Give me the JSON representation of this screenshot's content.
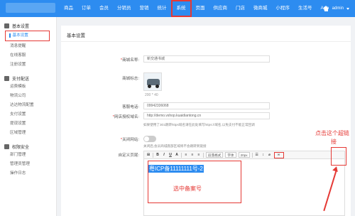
{
  "topbar": {
    "nav": [
      "商品",
      "订单",
      "会员",
      "分销员",
      "营销",
      "统计",
      "系统",
      "页面",
      "供应商",
      "门店",
      "微商城",
      "小程序",
      "生活号",
      "App"
    ],
    "active_nav": "系统",
    "user_name": "admin",
    "brand_color": "#2d8cf0"
  },
  "sidebar": {
    "groups": [
      {
        "title": "基本设置",
        "items": [
          "基本设置",
          "消息提醒",
          "在线客服",
          "注册设置"
        ]
      },
      {
        "title": "支付配送",
        "items": [
          "运费模板",
          "物流公司",
          "达达物流配置",
          "支付设置",
          "提现设置",
          "区域管理"
        ]
      },
      {
        "title": "权限安全",
        "items": [
          "部门管理",
          "管理员管理",
          "操作日志"
        ]
      }
    ],
    "active_item": "基本设置"
  },
  "main": {
    "section_title": "基本设置",
    "shop_name_label": "商城名称:",
    "shop_name_value": "新交通书城",
    "logo_label": "商城标志:",
    "logo_size": "200 * 40",
    "phone_label": "客服电话:",
    "phone_value": "09942336068",
    "domain_label": "网店授权域名:",
    "domain_value": "http://demo.vshop.kuaidiantong.cn",
    "domain_hint": "如果使用了301跳转https域名请在此处填写https://域名,以免支付不能正常回调",
    "close_label": "关闭网站:",
    "close_hint": "关闭后,会员商城底部区域将不会跳转到链接",
    "custom_label": "自定义页尾:",
    "editor_text": "粤ICP备11111111号-2"
  },
  "toolbar": {
    "font_family": "字体",
    "font_size": "20px",
    "style": "段落格式",
    "link_btn": "链接"
  },
  "annotations": {
    "click_text_line1": "点击这个超链",
    "click_text_line2": "接",
    "select_text": "选中备案号",
    "color": "#e53935"
  }
}
